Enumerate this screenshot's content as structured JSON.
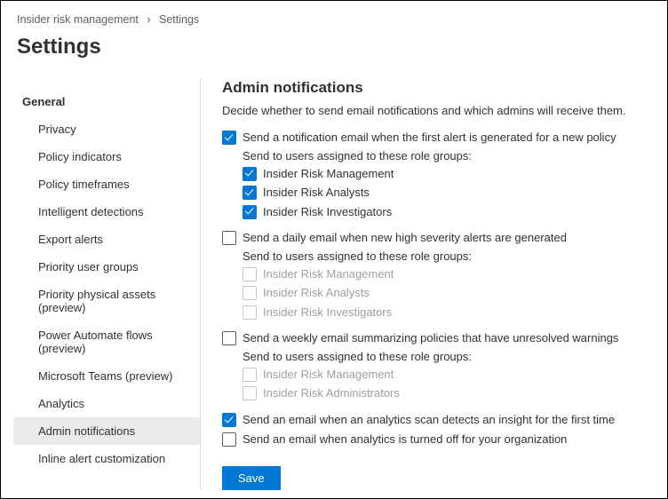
{
  "breadcrumb": {
    "parent": "Insider risk management",
    "current": "Settings"
  },
  "page_title": "Settings",
  "sidebar": {
    "group_label": "General",
    "items": [
      {
        "label": "Privacy"
      },
      {
        "label": "Policy indicators"
      },
      {
        "label": "Policy timeframes"
      },
      {
        "label": "Intelligent detections"
      },
      {
        "label": "Export alerts"
      },
      {
        "label": "Priority user groups"
      },
      {
        "label": "Priority physical assets (preview)"
      },
      {
        "label": "Power Automate flows (preview)"
      },
      {
        "label": "Microsoft Teams (preview)"
      },
      {
        "label": "Analytics"
      },
      {
        "label": "Admin notifications"
      },
      {
        "label": "Inline alert customization"
      }
    ]
  },
  "content": {
    "title": "Admin notifications",
    "description": "Decide whether to send email notifications and which admins will receive them.",
    "option1": {
      "label": "Send a notification email when the first alert is generated for a new policy",
      "sub_label": "Send to users assigned to these role groups:",
      "roles": [
        "Insider Risk Management",
        "Insider Risk Analysts",
        "Insider Risk Investigators"
      ]
    },
    "option2": {
      "label": "Send a daily email when new high severity alerts are generated",
      "sub_label": "Send to users assigned to these role groups:",
      "roles": [
        "Insider Risk Management",
        "Insider Risk Analysts",
        "Insider Risk Investigators"
      ]
    },
    "option3": {
      "label": "Send a weekly email summarizing policies that have unresolved warnings",
      "sub_label": "Send to users assigned to these role groups:",
      "roles": [
        "Insider Risk Management",
        "Insider Risk Administrators"
      ]
    },
    "option4": {
      "label": "Send an email when an analytics scan detects an insight for the first time"
    },
    "option5": {
      "label": "Send an email when analytics is turned off for your organization"
    },
    "save_button": "Save"
  }
}
